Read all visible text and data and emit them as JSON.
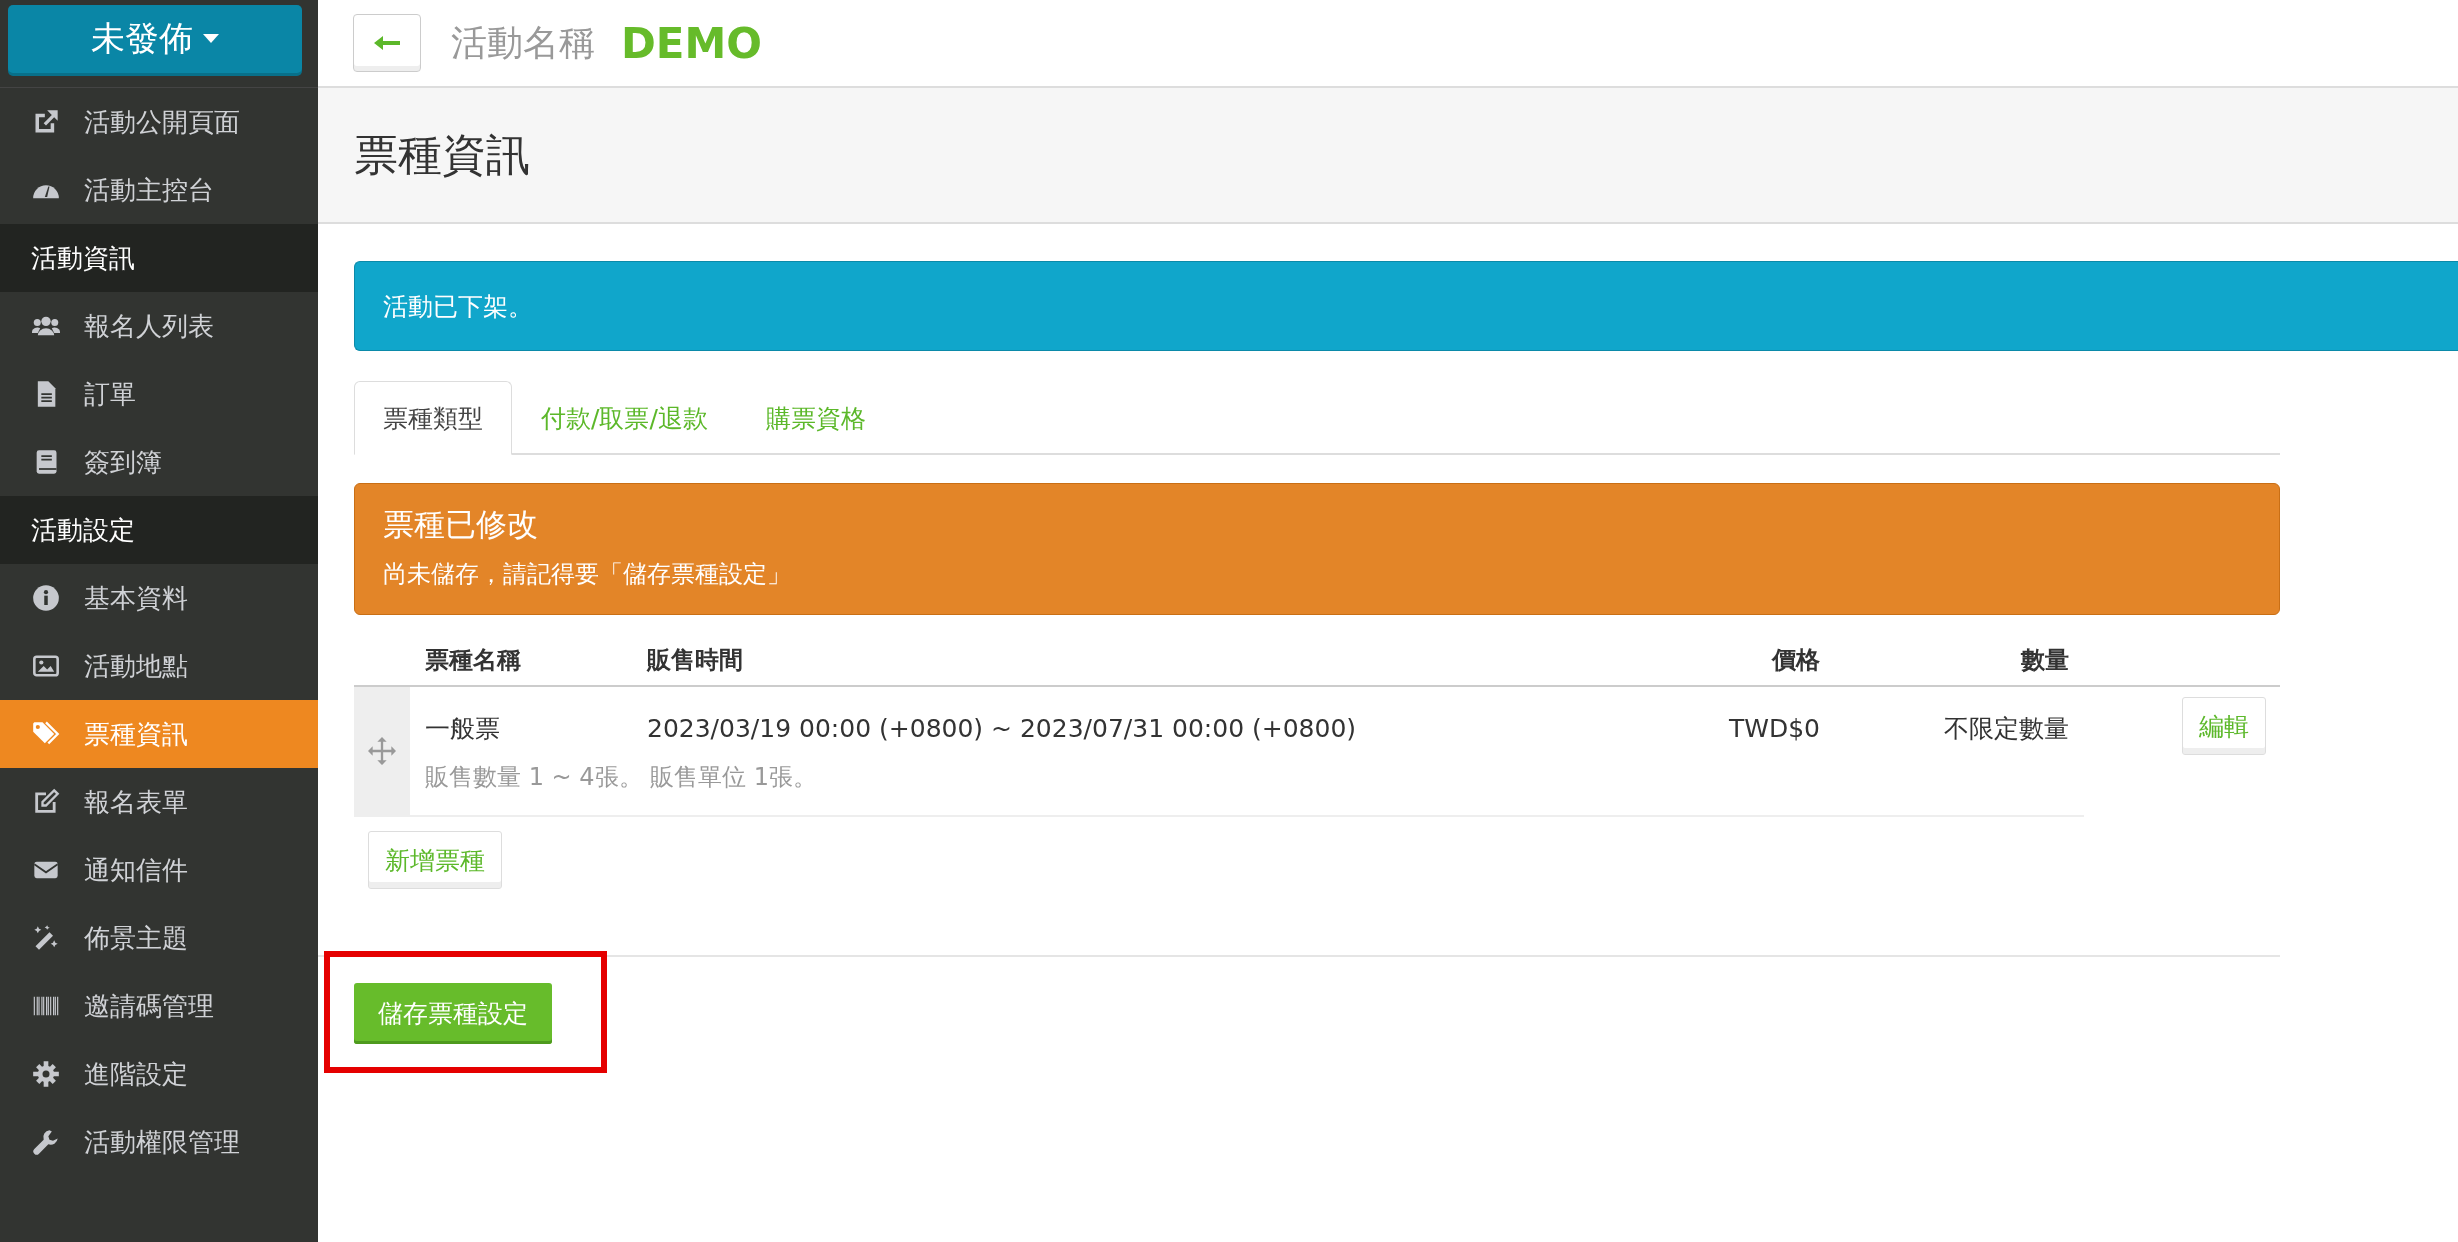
{
  "status_button": {
    "label": "未發佈"
  },
  "sidebar": {
    "items": [
      {
        "kind": "item",
        "label": "活動公開頁面",
        "selected": false
      },
      {
        "kind": "item",
        "label": "活動主控台",
        "selected": false
      },
      {
        "kind": "section",
        "label": "活動資訊"
      },
      {
        "kind": "item",
        "label": "報名人列表",
        "selected": false
      },
      {
        "kind": "item",
        "label": "訂單",
        "selected": false
      },
      {
        "kind": "item",
        "label": "簽到簿",
        "selected": false
      },
      {
        "kind": "section",
        "label": "活動設定"
      },
      {
        "kind": "item",
        "label": "基本資料",
        "selected": false
      },
      {
        "kind": "item",
        "label": "活動地點",
        "selected": false
      },
      {
        "kind": "item",
        "label": "票種資訊",
        "selected": true
      },
      {
        "kind": "item",
        "label": "報名表單",
        "selected": false
      },
      {
        "kind": "item",
        "label": "通知信件",
        "selected": false
      },
      {
        "kind": "item",
        "label": "佈景主題",
        "selected": false
      },
      {
        "kind": "item",
        "label": "邀請碼管理",
        "selected": false
      },
      {
        "kind": "item",
        "label": "進階設定",
        "selected": false
      },
      {
        "kind": "item",
        "label": "活動權限管理",
        "selected": false
      }
    ]
  },
  "header": {
    "caption": "活動名稱",
    "event_name": "DEMO"
  },
  "page_title": "票種資訊",
  "notice": "活動已下架。",
  "tabs": [
    {
      "label": "票種類型",
      "selected": true
    },
    {
      "label": "付款/取票/退款",
      "selected": false
    },
    {
      "label": "購票資格",
      "selected": false
    }
  ],
  "warning": {
    "title": "票種已修改",
    "message": "尚未儲存，請記得要「儲存票種設定」"
  },
  "table": {
    "columns": [
      "票種名稱",
      "販售時間",
      "價格",
      "數量"
    ],
    "rows": [
      {
        "name": "一般票",
        "sale_period": "2023/03/19 00:00 (+0800) ~ 2023/07/31 00:00 (+0800)",
        "price": "TWD$0",
        "quantity": "不限定數量",
        "details": "販售數量 1 ~ 4張。 販售單位 1張。",
        "action": "編輯"
      }
    ]
  },
  "add_button": {
    "label": "新增票種"
  },
  "save_button": {
    "label": "儲存票種設定",
    "highlighted": true
  }
}
